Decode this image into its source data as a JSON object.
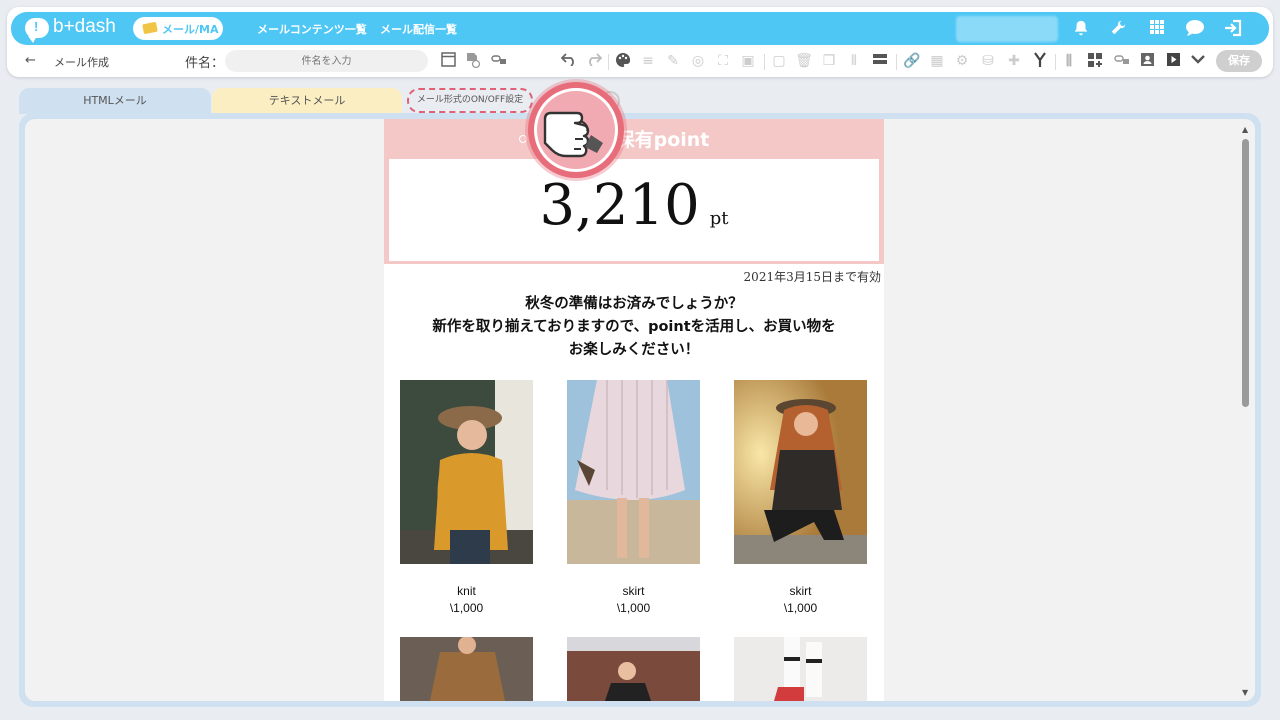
{
  "nav": {
    "logo_mark": "!",
    "logo_text": "b+dash",
    "active_pill": "メール/MA",
    "links": [
      "メールコンテンツ一覧",
      "メール配信一覧"
    ]
  },
  "subbar": {
    "back": "←",
    "page_label": "メール作成",
    "subject_label": "件名：",
    "subject_placeholder": "件名を入力",
    "save_label": "保存"
  },
  "tabs": {
    "html": "HTMLメール",
    "text": "テキストメール",
    "toggle": "メール形式のON/OFF設定",
    "help": "?"
  },
  "email": {
    "point_title": "現在の保有point",
    "point_value": "3,210",
    "point_unit": "pt",
    "expiry": "2021年3月15日まで有効",
    "message_lines": [
      "秋冬の準備はお済みでしょうか？",
      "新作を取り揃えておりますので、pointを活用し、お買い物を",
      "お楽しみください！"
    ],
    "products": [
      {
        "name": "knit",
        "price": "\\1,000"
      },
      {
        "name": "skirt",
        "price": "\\1,000"
      },
      {
        "name": "skirt",
        "price": "\\1,000"
      }
    ]
  },
  "colors": {
    "brand": "#4ec7f5",
    "point_bg": "#f5c8c8",
    "toggle_border": "#e06075",
    "pointer": "#e86d7a"
  },
  "icons": [
    "bell-icon",
    "wrench-icon",
    "grid-icon",
    "chat-icon",
    "logout-icon",
    "undo-icon",
    "redo-icon",
    "palette-icon",
    "save-button"
  ]
}
